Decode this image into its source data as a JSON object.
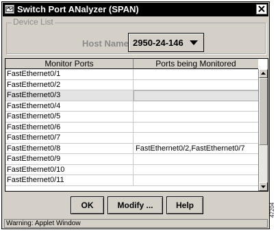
{
  "window": {
    "title": "Switch Port ANalyzer (SPAN)",
    "close_label": "x"
  },
  "device_list": {
    "legend": "Device List",
    "host_label": "Host Name:",
    "host_value": "2950-24-146"
  },
  "table": {
    "headers": [
      "Monitor Ports",
      "Ports being Monitored"
    ],
    "rows": [
      {
        "monitor": "FastEthernet0/1",
        "monitored": ""
      },
      {
        "monitor": "FastEthernet0/2",
        "monitored": ""
      },
      {
        "monitor": "FastEthernet0/3",
        "monitored": ""
      },
      {
        "monitor": "FastEthernet0/4",
        "monitored": ""
      },
      {
        "monitor": "FastEthernet0/5",
        "monitored": ""
      },
      {
        "monitor": "FastEthernet0/6",
        "monitored": ""
      },
      {
        "monitor": "FastEthernet0/7",
        "monitored": ""
      },
      {
        "monitor": "FastEthernet0/8",
        "monitored": "FastEthernet0/2,FastEthernet0/7"
      },
      {
        "monitor": "FastEthernet0/9",
        "monitored": ""
      },
      {
        "monitor": "FastEthernet0/10",
        "monitored": ""
      },
      {
        "monitor": "FastEthernet0/11",
        "monitored": ""
      }
    ],
    "selected_row": "FastEthernet0/3"
  },
  "buttons": {
    "ok": "OK",
    "modify": "Modify ...",
    "help": "Help"
  },
  "status": {
    "text": "Warning: Applet Window"
  },
  "figure_id": "47204"
}
